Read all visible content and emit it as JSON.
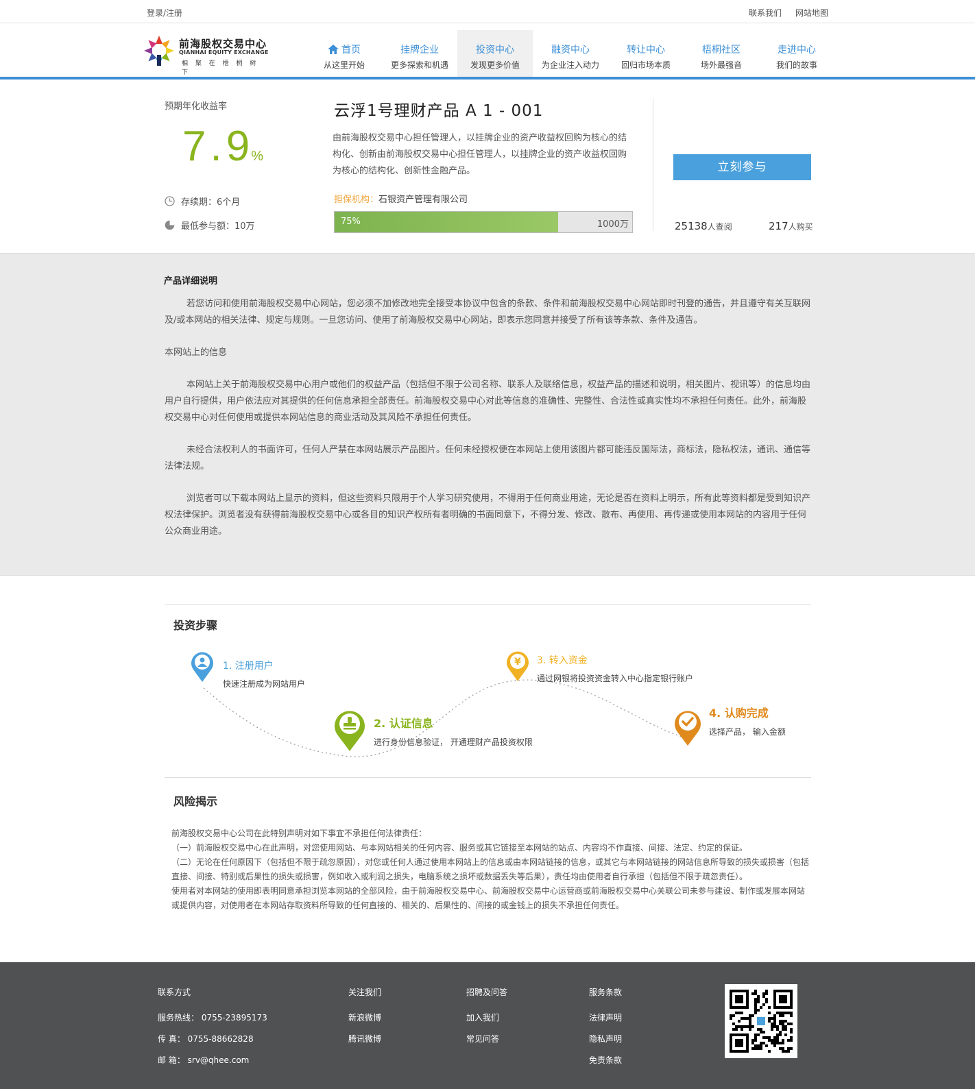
{
  "topbar": {
    "login": "登录/注册",
    "contact": "联系我们",
    "sitemap": "网站地图"
  },
  "brand": {
    "name_cn": "前海股权交易中心",
    "name_en": "QIANHAI EQUITY EXCHANGE",
    "slogan": "相 聚 在 梧 桐 树 下"
  },
  "nav": [
    {
      "title": "首页",
      "sub": "从这里开始"
    },
    {
      "title": "挂牌企业",
      "sub": "更多探索和机遇"
    },
    {
      "title": "投资中心",
      "sub": "发现更多价值"
    },
    {
      "title": "融资中心",
      "sub": "为企业注入动力"
    },
    {
      "title": "转让中心",
      "sub": "回归市场本质"
    },
    {
      "title": "梧桐社区",
      "sub": "场外最强音"
    },
    {
      "title": "走进中心",
      "sub": "我们的故事"
    }
  ],
  "product": {
    "rate_label": "预期年化收益率",
    "rate": "7.9",
    "rate_unit": "%",
    "term": "存续期：6个月",
    "min": "最低参与额：10万",
    "title": "云浮1号理财产品  A 1 - 001",
    "desc": "由前海股权交易中心担任管理人，以挂牌企业的资产收益权回购为核心的结构化、创新由前海股权交易中心担任管理人，以挂牌企业的资产收益权回购为核心的结构化、创新性金融产品。",
    "guarantor_key": "担保机构：",
    "guarantor": "石银资产管理有限公司",
    "progress_label": "75%",
    "progress_fraction": 0.75,
    "total": "1000万",
    "join": "立刻参与",
    "views": "25138",
    "views_unit": "人查阅",
    "buyers": "217",
    "buyers_unit": "人购买"
  },
  "detail": {
    "heading": "产品详细说明",
    "p1": "若您访问和使用前海股权交易中心网站，您必须不加修改地完全接受本协议中包含的条款、条件和前海股权交易中心网站即时刊登的通告，并且遵守有关互联网及/或本网站的相关法律、规定与规则。一旦您访问、使用了前海股权交易中心网站，即表示您同意并接受了所有该等条款、条件及通告。",
    "p2": "本网站上的信息",
    "p3": "本网站上关于前海股权交易中心用户或他们的权益产品（包括但不限于公司名称、联系人及联络信息，权益产品的描述和说明，相关图片、视讯等）的信息均由用户自行提供，用户依法应对其提供的任何信息承担全部责任。前海股权交易中心对此等信息的准确性、完整性、合法性或真实性均不承担任何责任。此外，前海股权交易中心对任何使用或提供本网站信息的商业活动及其风险不承担任何责任。",
    "p4": "未经合法权利人的书面许可，任何人严禁在本网站展示产品图片。任何未经授权便在本网站上使用该图片都可能违反国际法，商标法，隐私权法，通讯、通信等法律法规。",
    "p5": "浏览者可以下载本网站上显示的资料，但这些资料只限用于个人学习研究使用，不得用于任何商业用途，无论是否在资料上明示，所有此等资料都是受到知识产权法律保护。浏览者没有获得前海股权交易中心或各目的知识产权所有者明确的书面同意下，不得分发、修改、散布、再使用、再传递或使用本网站的内容用于任何公众商业用途。"
  },
  "steps": {
    "title": "投资步骤",
    "s1_name": "1. 注册用户",
    "s1_sub": "快速注册成为网站用户",
    "s2_name": "2. 认证信息",
    "s2_sub": "进行身份信息验证，  开通理财产品投资权限",
    "s3_name": "3. 转入资金",
    "s3_sub": "通过网银将投资资金转入中心指定银行账户",
    "s4_name": "4. 认购完成",
    "s4_sub": "选择产品，  输入金额",
    "colors": {
      "s1": "#4aa0dc",
      "s2": "#8ab41e",
      "s3": "#f0b224",
      "s4": "#e08a1e"
    }
  },
  "risk": {
    "title": "风险揭示",
    "l1": "前海股权交易中心公司在此特别声明对如下事宜不承担任何法律责任：",
    "l2": "（一）前海股权交易中心在此声明，对您使用网站、与本网站相关的任何内容、服务或其它链接至本网站的站点、内容均不作直接、间接、法定、约定的保证。",
    "l3": "（二）无论在任何原因下（包括但不限于疏忽原因），对您或任何人通过使用本网站上的信息或由本网站链接的信息，或其它与本网站链接的网站信息所导致的损失或损害（包括直接、间接、特别或后果性的损失或损害，例如收入或利润之损失，电脑系统之损坏或数据丢失等后果），责任均由使用者自行承担（包括但不限于疏忽责任）。",
    "l4": "使用者对本网站的使用即表明同意承担浏览本网站的全部风险，由于前海股权交易中心、前海股权交易中心运营商或前海股权交易中心关联公司未参与建设、制作或发展本网站或提供内容，对使用者在本网站存取资料所导致的任何直接的、相关的、后果性的、间接的或金钱上的损失不承担任何责任。"
  },
  "footer": {
    "contact_h": "联系方式",
    "hotline": "服务热线：  0755-23895173",
    "fax": "传     真：  0755-88662828",
    "email": "邮     箱：  srv@qhee.com",
    "follow_h": "关注我们",
    "weibo_sina": "新浪微博",
    "weibo_tx": "腾讯微博",
    "jobs_h": "招聘及问答",
    "join_us": "加入我们",
    "faq": "常见问答",
    "terms_h": "服务条款",
    "legal": "法律声明",
    "privacy": "隐私声明",
    "disclaimer": "免责条款"
  }
}
